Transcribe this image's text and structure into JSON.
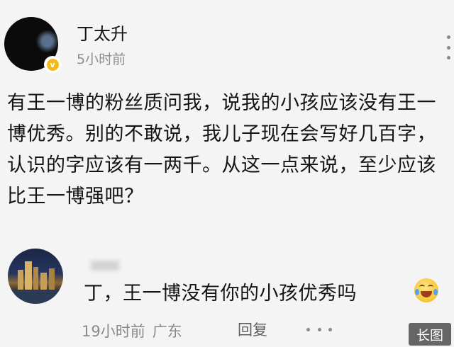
{
  "post": {
    "author_name": "丁太升",
    "time": "5小时前",
    "body": "有王一博的粉丝质问我，说我的小孩应该没有王一博优秀。别的不敢说，我儿子现在会写好几百字，认识的字应该有一两千。从这一点来说，至少应该比王一博强吧？"
  },
  "reply": {
    "text": "丁，王一博没有你的小孩优秀吗",
    "emoji": "laughing-crying-emoji",
    "time": "19小时前",
    "location": "广东",
    "reply_label": "回复"
  },
  "badge": {
    "long_image_label": "长图"
  },
  "colors": {
    "background": "#f4f4f4",
    "text": "#141414",
    "meta_text": "#8a8a8a",
    "verified_badge": "#f3b81b"
  }
}
